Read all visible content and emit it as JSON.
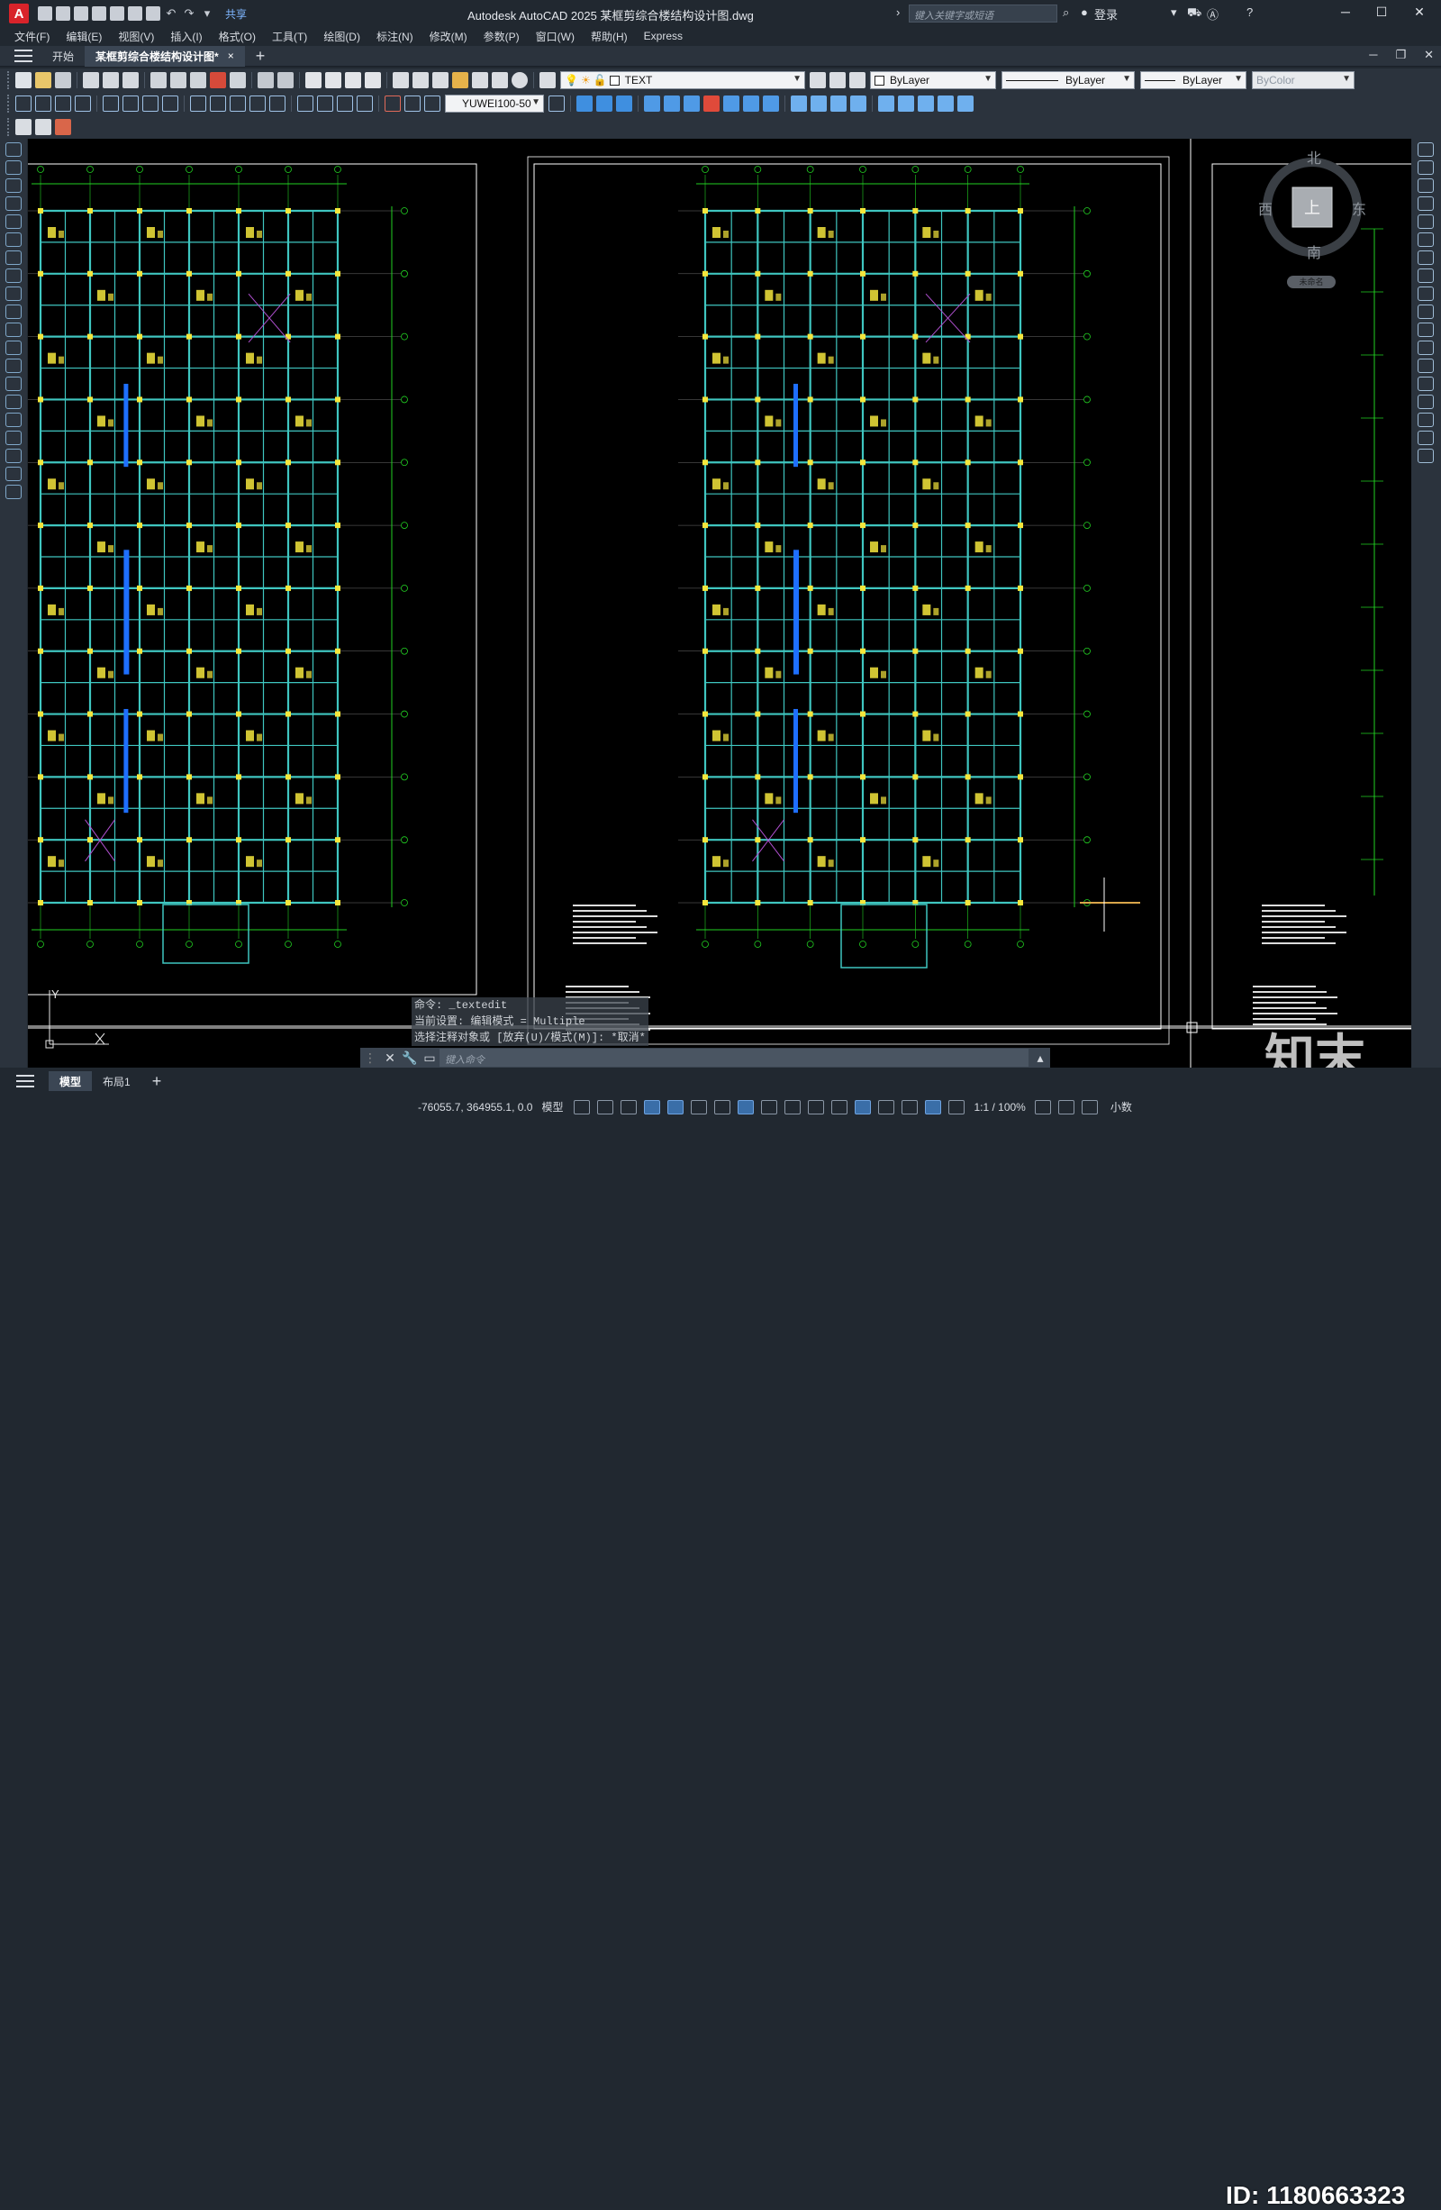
{
  "app": {
    "logo_letter": "A",
    "window_title": "Autodesk AutoCAD 2025    某框剪综合楼结构设计图.dwg",
    "share_label": "共享",
    "search_placeholder": "键入关键字或短语",
    "login_label": "登录"
  },
  "menu": [
    "文件(F)",
    "编辑(E)",
    "视图(V)",
    "插入(I)",
    "格式(O)",
    "工具(T)",
    "绘图(D)",
    "标注(N)",
    "修改(M)",
    "参数(P)",
    "窗口(W)",
    "帮助(H)",
    "Express"
  ],
  "tabs": {
    "start": "开始",
    "document": "某框剪综合楼结构设计图*",
    "close": "×",
    "add": "+"
  },
  "properties": {
    "text_style": "TEXT",
    "dim_style": "YUWEI100-50",
    "color": "ByLayer",
    "linetype": "ByLayer",
    "lineweight": "ByLayer",
    "plotstyle": "ByColor"
  },
  "viewcube": {
    "north": "北",
    "south": "南",
    "east": "东",
    "west": "西",
    "top_face": "上",
    "ucs_label": "未命名"
  },
  "ucs": {
    "y_axis": "Y"
  },
  "command": {
    "history": [
      "命令: _textedit",
      "当前设置: 编辑模式 = Multiple",
      "选择注释对象或 [放弃(U)/模式(M)]: *取消*"
    ],
    "placeholder": "键入命令"
  },
  "layout_tabs": [
    "模型",
    "布局1"
  ],
  "status": {
    "coordinates": "-76055.7, 364955.1, 0.0",
    "space": "模型",
    "annotation_scale": "1:1 / 100%",
    "units": "小数"
  },
  "watermark": {
    "id_text": "ID: 1180663323",
    "logo_text": "知末"
  },
  "colors": {
    "canvas": "#000000",
    "structure": "#3fc6c0",
    "gridlines": "#22d122",
    "columns": "#f5e63c",
    "shear_wall": "#1e6fff",
    "bracing": "#b050d0",
    "frame": "#ffffff"
  }
}
